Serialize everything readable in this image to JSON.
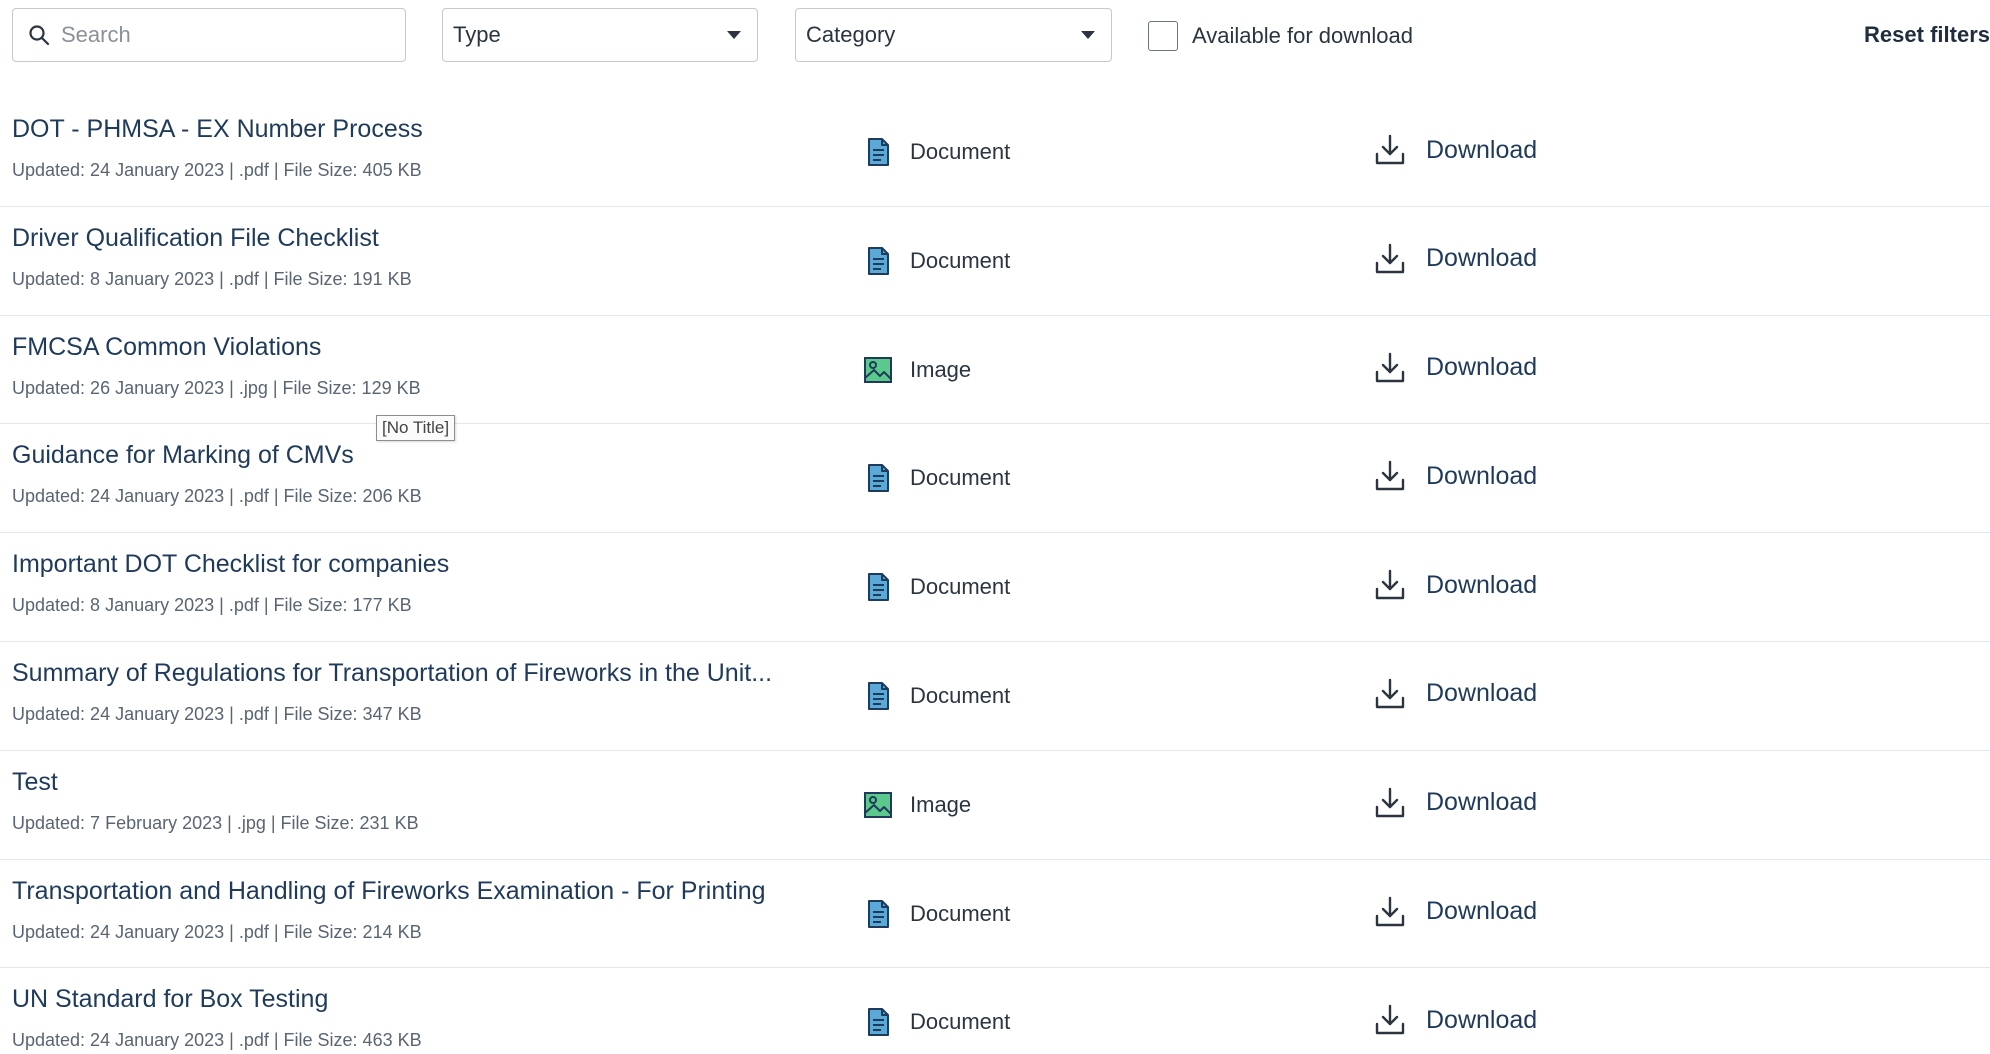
{
  "filters": {
    "search_placeholder": "Search",
    "type_label": "Type",
    "category_label": "Category",
    "available_label": "Available for download",
    "reset_label": "Reset filters"
  },
  "tooltip": "[No Title]",
  "download_label": "Download",
  "items": [
    {
      "title": "DOT - PHMSA - EX Number Process",
      "meta": "Updated: 24 January 2023 | .pdf | File Size: 405 KB",
      "type": "Document",
      "type_icon": "document-icon"
    },
    {
      "title": "Driver Qualification File Checklist",
      "meta": "Updated: 8 January 2023 | .pdf | File Size: 191 KB",
      "type": "Document",
      "type_icon": "document-icon"
    },
    {
      "title": "FMCSA Common Violations",
      "meta": "Updated: 26 January 2023 | .jpg | File Size: 129 KB",
      "type": "Image",
      "type_icon": "image-icon"
    },
    {
      "title": "Guidance for Marking of CMVs",
      "meta": "Updated: 24 January 2023 | .pdf | File Size: 206 KB",
      "type": "Document",
      "type_icon": "document-icon"
    },
    {
      "title": "Important DOT Checklist for companies",
      "meta": "Updated: 8 January 2023 | .pdf | File Size: 177 KB",
      "type": "Document",
      "type_icon": "document-icon"
    },
    {
      "title": "Summary of Regulations for Transportation of Fireworks in the Unit...",
      "meta": "Updated: 24 January 2023 | .pdf | File Size: 347 KB",
      "type": "Document",
      "type_icon": "document-icon"
    },
    {
      "title": "Test",
      "meta": "Updated: 7 February 2023 | .jpg | File Size: 231 KB",
      "type": "Image",
      "type_icon": "image-icon"
    },
    {
      "title": "Transportation and Handling of Fireworks Examination - For Printing",
      "meta": "Updated: 24 January 2023 | .pdf | File Size: 214 KB",
      "type": "Document",
      "type_icon": "document-icon"
    },
    {
      "title": "UN Standard for Box Testing",
      "meta": "Updated: 24 January 2023 | .pdf | File Size: 463 KB",
      "type": "Document",
      "type_icon": "document-icon"
    }
  ],
  "colors": {
    "document_icon": "#5aa9d6",
    "image_icon": "#5cc98c",
    "title_text": "#1f3a5a",
    "divider": "#e3e6ea"
  }
}
